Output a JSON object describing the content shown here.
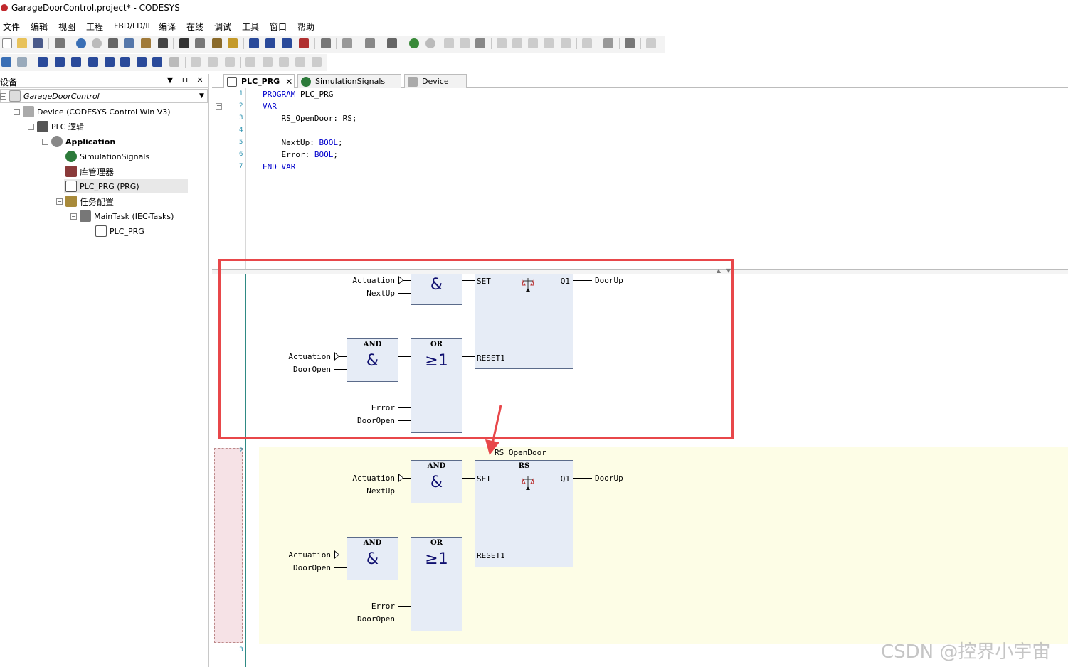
{
  "window": {
    "title": "GarageDoorControl.project* - CODESYS"
  },
  "menu": [
    "文件",
    "编辑",
    "视图",
    "工程",
    "FBD/LD/IL",
    "编译",
    "在线",
    "调试",
    "工具",
    "窗口",
    "帮助"
  ],
  "devices_panel": {
    "title": "设备",
    "pin_label": "▼",
    "dock_label": "⊓",
    "close_label": "✕"
  },
  "tree": [
    {
      "label": "GarageDoorControl",
      "toggle": "−"
    },
    {
      "label": "Device (CODESYS Control Win V3)",
      "toggle": "−"
    },
    {
      "label": "PLC 逻辑",
      "toggle": "−"
    },
    {
      "label": "Application",
      "toggle": "−"
    },
    {
      "label": "SimulationSignals",
      "toggle": ""
    },
    {
      "label": "库管理器",
      "toggle": ""
    },
    {
      "label": "PLC_PRG (PRG)",
      "toggle": ""
    },
    {
      "label": "任务配置",
      "toggle": "−"
    },
    {
      "label": "MainTask (IEC-Tasks)",
      "toggle": "−"
    },
    {
      "label": "PLC_PRG",
      "toggle": ""
    }
  ],
  "tabs": [
    {
      "label": "PLC_PRG",
      "close": "✕"
    },
    {
      "label": "SimulationSignals"
    },
    {
      "label": "Device"
    }
  ],
  "code": {
    "line_numbers": [
      "1",
      "2",
      "3",
      "4",
      "5",
      "6",
      "7"
    ],
    "lines": [
      {
        "kw": "PROGRAM",
        "rest": " PLC_PRG"
      },
      {
        "kw": "VAR",
        "rest": ""
      },
      {
        "kw": "",
        "rest": "    RS_OpenDoor: RS;"
      },
      {
        "kw": "",
        "rest": ""
      },
      {
        "kw": "",
        "rest": "    NextUp: ",
        "kw2": "BOOL",
        "tail": ";"
      },
      {
        "kw": "",
        "rest": "    Error: ",
        "kw2": "BOOL",
        "tail": ";"
      },
      {
        "kw": "END_VAR",
        "rest": ""
      }
    ]
  },
  "fbd": {
    "net_numbers": [
      "2",
      "3"
    ],
    "net1": {
      "and_sym": "&",
      "and2_name": "AND",
      "and2_sym": "&",
      "or_name": "OR",
      "or_sym": "≥1",
      "rs_set": "SET",
      "rs_q1": "Q1",
      "rs_reset": "RESET1",
      "in_actuation1": "Actuation",
      "in_nextup": "NextUp",
      "in_actuation2": "Actuation",
      "in_dooropen1": "DoorOpen",
      "in_error": "Error",
      "in_dooropen2": "DoorOpen",
      "out": "DoorUp"
    },
    "net2": {
      "instance": "RS_OpenDoor",
      "and_name": "AND",
      "and_sym": "&",
      "and2_name": "AND",
      "and2_sym": "&",
      "or_name": "OR",
      "or_sym": "≥1",
      "rs_name": "RS",
      "rs_set": "SET",
      "rs_q1": "Q1",
      "rs_reset": "RESET1",
      "in_actuation1": "Actuation",
      "in_nextup": "NextUp",
      "in_actuation2": "Actuation",
      "in_dooropen1": "DoorOpen",
      "in_error": "Error",
      "in_dooropen2": "DoorOpen",
      "out": "DoorUp"
    }
  },
  "watermark": "CSDN @控界小宇宙",
  "colors": {
    "accent_red": "#e8474a",
    "fb_fill": "#e6ecf6",
    "net_bg": "#fdfde6",
    "keyword": "#0000cc"
  }
}
